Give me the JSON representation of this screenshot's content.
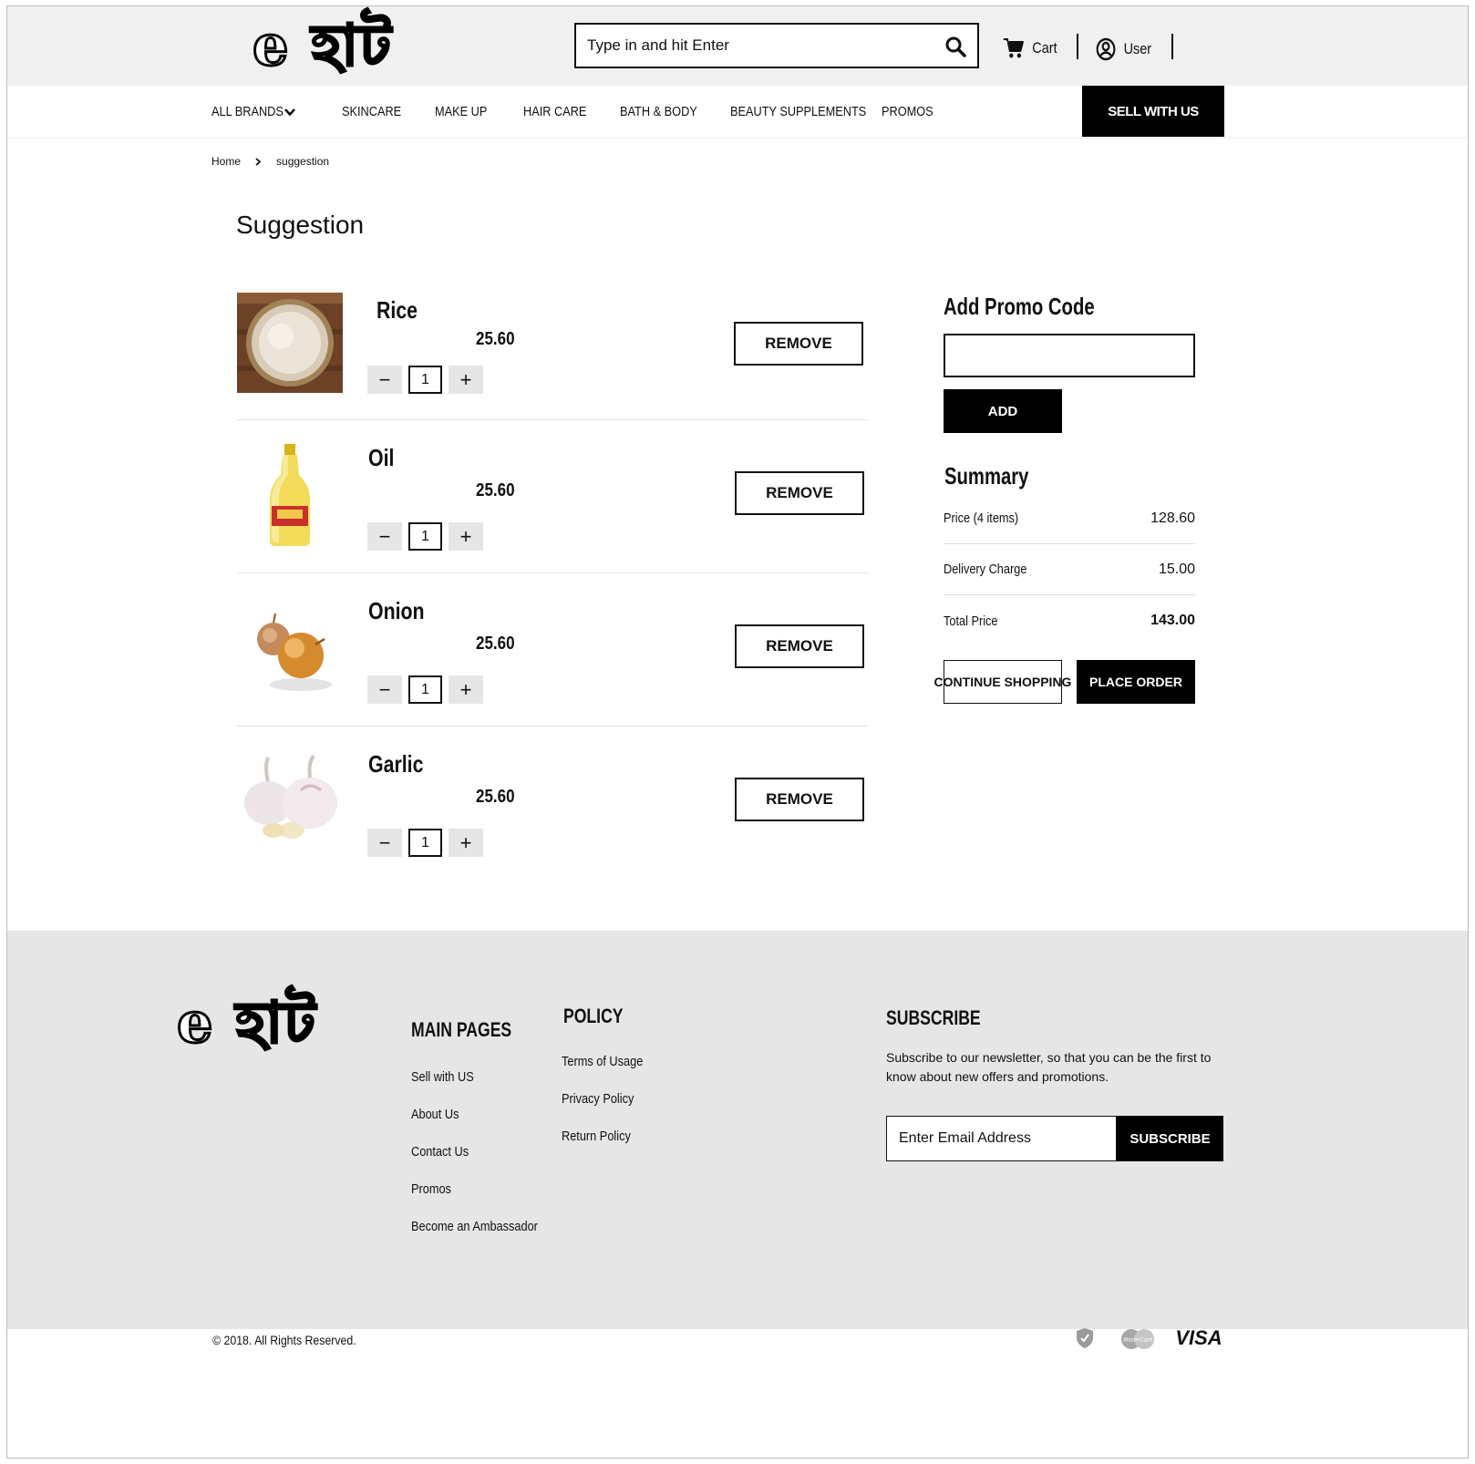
{
  "brand": {
    "logo_text": "e হাট"
  },
  "search": {
    "placeholder": "Type in and hit Enter"
  },
  "header": {
    "cart_label": "Cart",
    "user_label": "User"
  },
  "nav": {
    "items": [
      "ALL BRANDS",
      "SKINCARE",
      "MAKE UP",
      "HAIR CARE",
      "BATH & BODY",
      "BEAUTY SUPPLEMENTS",
      "PROMOS"
    ],
    "sell_label": "SELL WITH US"
  },
  "breadcrumb": {
    "home": "Home",
    "current": "suggestion"
  },
  "page": {
    "title": "Suggestion"
  },
  "items": [
    {
      "name": "Rice",
      "price": "25.60",
      "qty": "1",
      "image": "rice-image"
    },
    {
      "name": "Oil",
      "price": "25.60",
      "qty": "1",
      "image": "oil-image"
    },
    {
      "name": "Onion",
      "price": "25.60",
      "qty": "1",
      "image": "onion-image"
    },
    {
      "name": "Garlic",
      "price": "25.60",
      "qty": "1",
      "image": "garlic-image"
    }
  ],
  "item_actions": {
    "remove_label": "REMOVE",
    "minus_symbol": "−",
    "plus_symbol": "+"
  },
  "promo": {
    "title": "Add Promo Code",
    "add_label": "ADD"
  },
  "summary": {
    "title": "Summary",
    "price_label": "Price (4 items)",
    "price_value": "128.60",
    "delivery_label": "Delivery Charge",
    "delivery_value": "15.00",
    "total_label": "Total Price",
    "total_value": "143.00",
    "continue_label": "CONTINUE SHOPPING",
    "place_order_label": "PLACE ORDER"
  },
  "footer": {
    "main_pages_title": "MAIN PAGES",
    "main_pages": [
      "Sell with US",
      "About Us",
      "Contact Us",
      "Promos",
      "Become an Ambassador"
    ],
    "policy_title": "POLICY",
    "policy": [
      "Terms of Usage",
      "Privacy Policy",
      "Return Policy"
    ],
    "subscribe_title": "SUBSCRIBE",
    "subscribe_text": "Subscribe to our newsletter, so that you can be the first to know about new offers and promotions.",
    "email_placeholder": "Enter Email Address",
    "subscribe_label": "SUBSCRIBE",
    "copyright": "© 2018. All Rights Reserved.",
    "payment_visa": "VISA",
    "payment_mastercard": "MasterCard"
  },
  "icons": [
    "search-icon",
    "cart-icon",
    "user-icon",
    "chevron-down-icon",
    "chevron-right-icon",
    "shield-icon",
    "mastercard-icon",
    "visa-icon"
  ],
  "colors": {
    "topbar": "#f0f0f0",
    "footer": "#e6e6e6",
    "primary": "#000000",
    "accent_text": "#ffffff"
  }
}
